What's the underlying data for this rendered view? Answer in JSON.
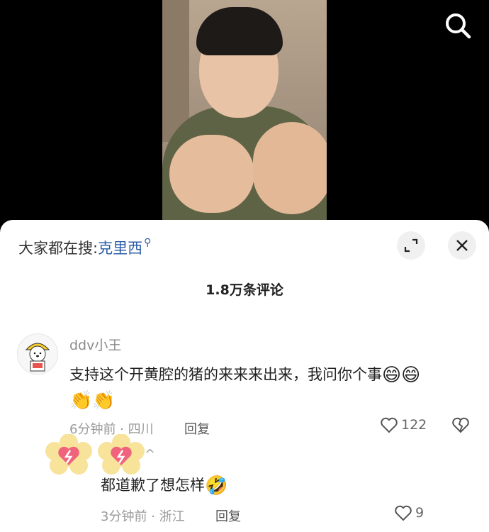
{
  "header": {
    "search_icon": "search-icon"
  },
  "sheet": {
    "trending_prefix": "大家都在搜:",
    "trending_term": "克里西",
    "trending_icon": "search-small-icon",
    "expand_icon": "expand-icon",
    "close_icon": "close-icon",
    "comment_count": "1.8万条评论"
  },
  "comments": [
    {
      "username": "ddv小王",
      "avatar_icon": "bear-avatar-icon",
      "text": "支持这个开黄腔的猪的来来来出来，我问你个事",
      "emojis": [
        "😄",
        "😄",
        "👏",
        "👏"
      ],
      "time_location": "6分钟前 · 四川",
      "reply_label": "回复",
      "like_count": "122",
      "like_icon": "heart-icon",
      "dislike_icon": "broken-heart-icon"
    },
    {
      "username_partial": "^",
      "text": "都道歉了想怎样",
      "emojis": [
        "🤣"
      ],
      "time_location": "3分钟前 · 浙江",
      "reply_label": "回复",
      "like_count": "9",
      "sticker_icon": "heart-lightning-sticker-icon"
    }
  ],
  "colors": {
    "link": "#2b5ea8",
    "sticker_petal": "#f8e39a",
    "sticker_heart": "#f0637c"
  }
}
